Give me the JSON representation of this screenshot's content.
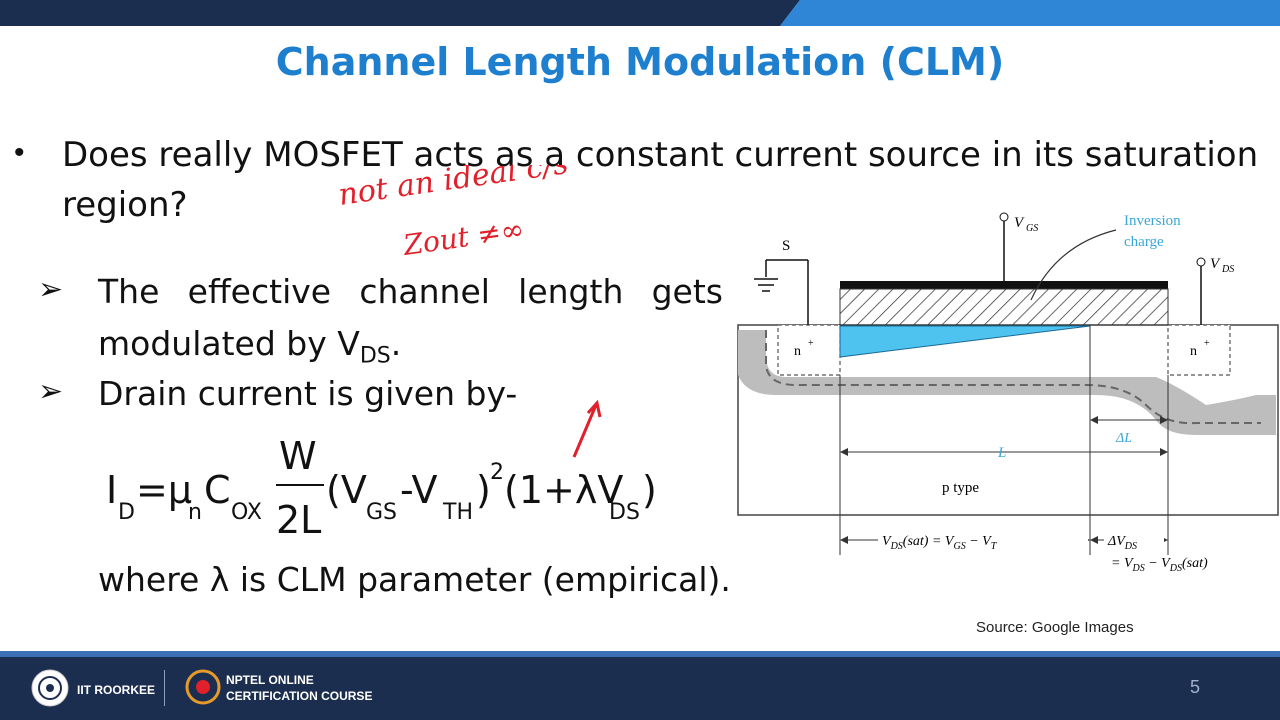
{
  "slide": {
    "title": "Channel Length Modulation (CLM)",
    "question": "Does really MOSFET acts as a constant current source in its saturation region?",
    "points": [
      "The effective channel length gets modulated by V",
      "Drain current is given by-"
    ],
    "vds_sub": "DS",
    "where_text": "where λ is CLM parameter (empirical).",
    "annotations": {
      "line1": "not an ideal c/s",
      "line2": "Zout ≠∞"
    },
    "source": "Source: Google Images",
    "page_number": "5"
  },
  "equation": {
    "I": "I",
    "D": "D",
    "eq": "=μ",
    "n": "n",
    "C": "C",
    "OX": "OX",
    "W": "W",
    "twoL": "2L",
    "open": "(V",
    "GS": "GS",
    "minus": "-V",
    "TH": "TH",
    "close": ")",
    "sq": "2",
    "paren2": "(1+λV",
    "DS": "DS",
    "close2": ")"
  },
  "diagram": {
    "S": "S",
    "VGS": "V",
    "VGS_sub": "GS",
    "VDS": "V",
    "VDS_sub": "DS",
    "inversion1": "Inversion",
    "inversion2": "charge",
    "n_plus": "n",
    "plus": "+",
    "L": "L",
    "deltaL": "ΔL",
    "ptype": "p type",
    "vdsat": "V",
    "vdsat_sub": "DS",
    "vdsat_rest": "(sat) = V",
    "vgs_sub2": "GS",
    "minus_vt": " − V",
    "vt_sub": "T",
    "dvds": "ΔV",
    "dvds_sub": "DS",
    "eq2": "= V",
    "eq2_sub": "DS",
    "eq2_rest": " − V",
    "eq2_sub2": "DS",
    "eq2_end": "(sat)"
  },
  "footer": {
    "iit": "IIT ROORKEE",
    "nptel1": "NPTEL ONLINE",
    "nptel2": "CERTIFICATION COURSE"
  },
  "colors": {
    "title": "#1f7fcf",
    "footer": "#1c2e4f",
    "inversion": "#4fc3f0",
    "ink": "#e0202a"
  }
}
